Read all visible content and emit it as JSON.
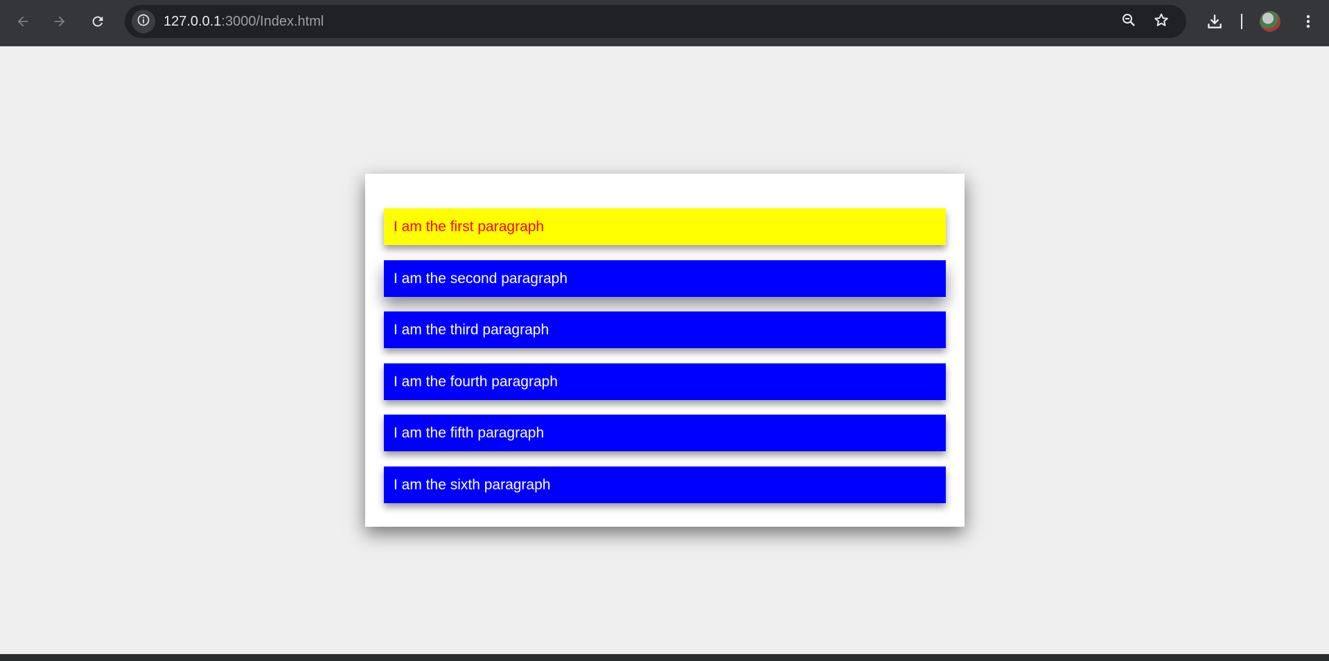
{
  "browser": {
    "url_host": "127.0.0.1",
    "url_path": ":3000/Index.html",
    "icons": {
      "back": "arrow-left-icon",
      "forward": "arrow-right-icon",
      "reload": "reload-icon",
      "site_info": "info-icon",
      "zoom": "zoom-out-icon",
      "bookmark": "star-icon",
      "downloads": "download-icon",
      "menu": "kebab-menu-icon"
    },
    "colors": {
      "toolbar": "#35363a",
      "omnibox": "#202124"
    }
  },
  "page": {
    "paragraphs": [
      {
        "text": "I am the first paragraph",
        "background": "#ffff00",
        "color": "#ff0000"
      },
      {
        "text": "I am the second paragraph",
        "background": "#0000ff",
        "color": "#ffffff"
      },
      {
        "text": "I am the third paragraph",
        "background": "#0000ff",
        "color": "#ffffff"
      },
      {
        "text": "I am the fourth paragraph",
        "background": "#0000ff",
        "color": "#ffffff"
      },
      {
        "text": "I am the fifth paragraph",
        "background": "#0000ff",
        "color": "#ffffff"
      },
      {
        "text": "I am the sixth paragraph",
        "background": "#0000ff",
        "color": "#ffffff"
      }
    ]
  }
}
